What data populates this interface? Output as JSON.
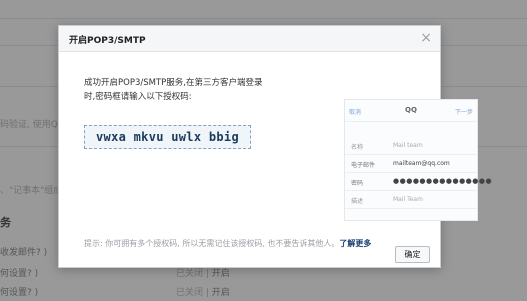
{
  "background": {
    "frag1": "码验证, 使用QQ",
    "frag2": "、\"记事本\"组成",
    "section_title": "务",
    "row1_label": "收发邮件? )",
    "row2_label": "何设置? )",
    "row3_label": "何设置? )",
    "row2_status_off": "已关闭 |",
    "row2_status_action": "开启",
    "row3_status_off": "已关闭 |",
    "row3_status_action": "开启"
  },
  "dialog": {
    "title": "开启POP3/SMTP",
    "close_symbol": "×",
    "message": "成功开启POP3/SMTP服务,在第三方客户端登录时,密码框请输入以下授权码:",
    "auth_code": "vwxa mkvu uwlx bbig",
    "mock": {
      "cancel": "取消",
      "title": "QQ",
      "next": "下一步",
      "rows": [
        {
          "label": "名称",
          "value": "Mail team"
        },
        {
          "label": "电子邮件",
          "value": "mailteam@qq.com"
        },
        {
          "label": "密码",
          "value": "●●●●●●●●●●●●●●●"
        },
        {
          "label": "描述",
          "value": "Mail Team"
        }
      ]
    },
    "tip": "提示: 你可拥有多个授权码, 所以无需记住该授权码, 也不要告诉其他人。",
    "tip_link": "了解更多",
    "ok_label": "确定"
  }
}
